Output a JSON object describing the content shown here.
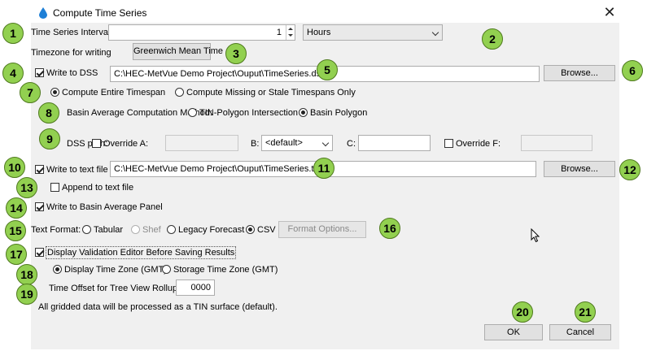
{
  "window": {
    "title": "Compute Time Series",
    "close_icon": "close-icon",
    "app_icon": "water-drop-icon"
  },
  "interval": {
    "label": "Time Series Interval:",
    "value": "1",
    "unit": "Hours"
  },
  "timezone": {
    "label": "Timezone for writing",
    "button": "Greenwich Mean Time"
  },
  "dss": {
    "write_label": "Write to DSS",
    "write_checked": true,
    "path_value": "C:\\HEC-MetVue Demo Project\\Ouput\\TimeSeries.dss",
    "browse": "Browse...",
    "compute_entire": "Compute Entire Timespan",
    "compute_missing": "Compute Missing or Stale Timespans Only",
    "basin_method_label": "Basin Average Computation Method:",
    "tin_polygon": "TIN-Polygon Intersection",
    "basin_polygon": "Basin Polygon",
    "path_label": "DSS path:",
    "override_a": "Override A:",
    "b_label": "B:",
    "b_value": "<default>",
    "c_label": "C:",
    "override_f": "Override F:"
  },
  "text_file": {
    "write_label": "Write to text file",
    "write_checked": true,
    "path_value": "C:\\HEC-MetVue Demo Project\\Ouput\\TimeSeries.txt",
    "browse": "Browse...",
    "append_label": "Append to text file"
  },
  "basin_panel": {
    "label": "Write to Basin Average Panel",
    "checked": true
  },
  "text_format": {
    "label": "Text Format:",
    "options": [
      "Tabular",
      "Shef",
      "Legacy Forecast",
      "CSV"
    ],
    "selected": "CSV",
    "format_options_button": "Format Options..."
  },
  "validation": {
    "label": "Display Validation Editor Before Saving Results",
    "checked": true,
    "display_tz": "Display Time Zone (GMT)",
    "storage_tz": "Storage Time Zone (GMT)",
    "offset_label": "Time Offset for Tree View Rollup:",
    "offset_value": "0000"
  },
  "note": "All gridded data will be processed as a TIN surface (default).",
  "actions": {
    "ok": "OK",
    "cancel": "Cancel"
  },
  "badges": [
    "1",
    "2",
    "3",
    "4",
    "5",
    "6",
    "7",
    "8",
    "9",
    "10",
    "11",
    "12",
    "13",
    "14",
    "15",
    "16",
    "17",
    "18",
    "19",
    "20",
    "21"
  ],
  "colors": {
    "badge_fill": "#92d050",
    "drop": "#1e7fd6"
  }
}
